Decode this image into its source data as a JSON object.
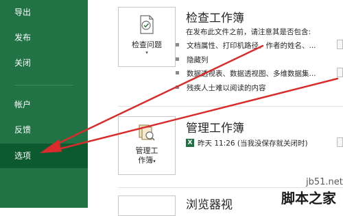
{
  "sidebar": {
    "items": [
      {
        "label": "导出"
      },
      {
        "label": "发布"
      },
      {
        "label": "关闭"
      },
      {
        "label": "帐户"
      },
      {
        "label": "反馈"
      },
      {
        "label": "选项",
        "selected": true
      }
    ]
  },
  "inspect": {
    "tile_label": "检查问题",
    "title": "检查工作簿",
    "desc": "在发布此文件之前，请注意其是否包含:",
    "bullets": [
      "文档属性、打印机路径、作者的姓名、...",
      "隐藏列",
      "数据透视表、数据透视图、多维数据集...",
      "残疾人士难以阅读的内容"
    ]
  },
  "manage": {
    "tile_label_line1": "管理工",
    "tile_label_line2": "作簿",
    "title": "管理工作簿",
    "version": "昨天 11:26 (当我没保存就关闭时)"
  },
  "browser": {
    "title": "浏览器视"
  },
  "watermark": {
    "site": "jb51.net",
    "brand": "脚本之家"
  },
  "colors": {
    "sidebar_bg": "#217346",
    "selected_bg": "#0e5a30",
    "arrow": "#d92b2b"
  }
}
